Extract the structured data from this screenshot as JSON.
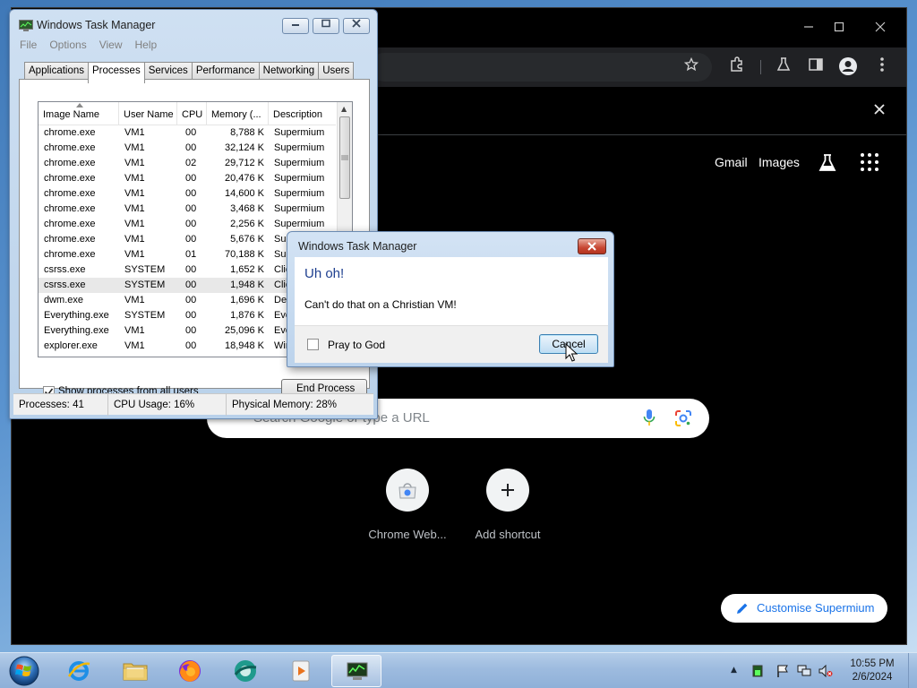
{
  "browser": {
    "ntp": {
      "gmail": "Gmail",
      "images": "Images",
      "search_placeholder": "Search Google or type a URL",
      "shortcuts": [
        {
          "label": "Chrome Web..."
        },
        {
          "label": "Add shortcut"
        }
      ],
      "customise_label": "Customise Supermium"
    }
  },
  "taskmgr": {
    "title": "Windows Task Manager",
    "menu": [
      "File",
      "Options",
      "View",
      "Help"
    ],
    "tabs": [
      "Applications",
      "Processes",
      "Services",
      "Performance",
      "Networking",
      "Users"
    ],
    "active_tab": "Processes",
    "columns": [
      "Image Name",
      "User Name",
      "CPU",
      "Memory (...",
      "Description"
    ],
    "processes": [
      {
        "name": "chrome.exe",
        "user": "VM1",
        "cpu": "00",
        "mem": "8,788 K",
        "desc": "Supermium"
      },
      {
        "name": "chrome.exe",
        "user": "VM1",
        "cpu": "00",
        "mem": "32,124 K",
        "desc": "Supermium"
      },
      {
        "name": "chrome.exe",
        "user": "VM1",
        "cpu": "02",
        "mem": "29,712 K",
        "desc": "Supermium"
      },
      {
        "name": "chrome.exe",
        "user": "VM1",
        "cpu": "00",
        "mem": "20,476 K",
        "desc": "Supermium"
      },
      {
        "name": "chrome.exe",
        "user": "VM1",
        "cpu": "00",
        "mem": "14,600 K",
        "desc": "Supermium"
      },
      {
        "name": "chrome.exe",
        "user": "VM1",
        "cpu": "00",
        "mem": "3,468 K",
        "desc": "Supermium"
      },
      {
        "name": "chrome.exe",
        "user": "VM1",
        "cpu": "00",
        "mem": "2,256 K",
        "desc": "Supermium"
      },
      {
        "name": "chrome.exe",
        "user": "VM1",
        "cpu": "00",
        "mem": "5,676 K",
        "desc": "Supermium"
      },
      {
        "name": "chrome.exe",
        "user": "VM1",
        "cpu": "01",
        "mem": "70,188 K",
        "desc": "Supermium"
      },
      {
        "name": "csrss.exe",
        "user": "SYSTEM",
        "cpu": "00",
        "mem": "1,652 K",
        "desc": "Clie"
      },
      {
        "name": "csrss.exe",
        "user": "SYSTEM",
        "cpu": "00",
        "mem": "1,948 K",
        "desc": "Clie"
      },
      {
        "name": "dwm.exe",
        "user": "VM1",
        "cpu": "00",
        "mem": "1,696 K",
        "desc": "Des"
      },
      {
        "name": "Everything.exe",
        "user": "SYSTEM",
        "cpu": "00",
        "mem": "1,876 K",
        "desc": "Eve"
      },
      {
        "name": "Everything.exe",
        "user": "VM1",
        "cpu": "00",
        "mem": "25,096 K",
        "desc": "Eve"
      },
      {
        "name": "explorer.exe",
        "user": "VM1",
        "cpu": "00",
        "mem": "18,948 K",
        "desc": "Win"
      }
    ],
    "selected_row_index": 10,
    "show_all_label": "Show processes from all users",
    "show_all_checked": true,
    "end_process_label": "End Process",
    "status": {
      "processes": "Processes: 41",
      "cpu": "CPU Usage: 16%",
      "memory": "Physical Memory: 28%"
    }
  },
  "dialog": {
    "title": "Windows Task Manager",
    "heading": "Uh oh!",
    "message": "Can't do that on a Christian VM!",
    "checkbox_label": "Pray to God",
    "checkbox_checked": false,
    "cancel_label": "Cancel"
  },
  "taskbar": {
    "apps": [
      "internet-explorer",
      "file-explorer",
      "firefox",
      "supermium",
      "media-player",
      "task-manager"
    ],
    "active_app": "task-manager",
    "time": "10:55 PM",
    "date": "2/6/2024"
  },
  "colors": {
    "accent_blue": "#1a73e8",
    "dialog_heading": "#1e3f8f",
    "ntp_background": "#000000",
    "toolbar": "#202124"
  }
}
